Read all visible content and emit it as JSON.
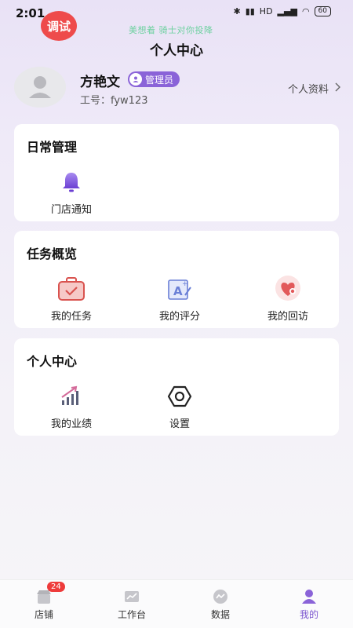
{
  "status": {
    "time": "2:01",
    "battery": "60",
    "signal_text": "HD"
  },
  "debug_badge": "调试",
  "marquee": "美想着 骑士对你投降",
  "page_title": "个人中心",
  "profile": {
    "name": "方艳文",
    "role": "管理员",
    "work_id": "工号：fyw123",
    "link": "个人资料"
  },
  "cards": {
    "daily": {
      "title": "日常管理",
      "items": [
        {
          "label": "门店通知",
          "icon": "bell-icon"
        }
      ]
    },
    "tasks": {
      "title": "任务概览",
      "items": [
        {
          "label": "我的任务",
          "icon": "briefcase-check-icon"
        },
        {
          "label": "我的评分",
          "icon": "rating-icon"
        },
        {
          "label": "我的回访",
          "icon": "heart-chat-icon"
        }
      ]
    },
    "personal": {
      "title": "个人中心",
      "items": [
        {
          "label": "我的业绩",
          "icon": "performance-chart-icon"
        },
        {
          "label": "设置",
          "icon": "gear-icon"
        }
      ]
    }
  },
  "nav": {
    "items": [
      {
        "label": "店铺",
        "badge": "24"
      },
      {
        "label": "工作台"
      },
      {
        "label": "数据"
      },
      {
        "label": "我的"
      }
    ],
    "active": "我的"
  },
  "colors": {
    "accent": "#8a63d8",
    "badge_red": "#ee4b4b",
    "marquee_green": "#6ed1a0"
  }
}
